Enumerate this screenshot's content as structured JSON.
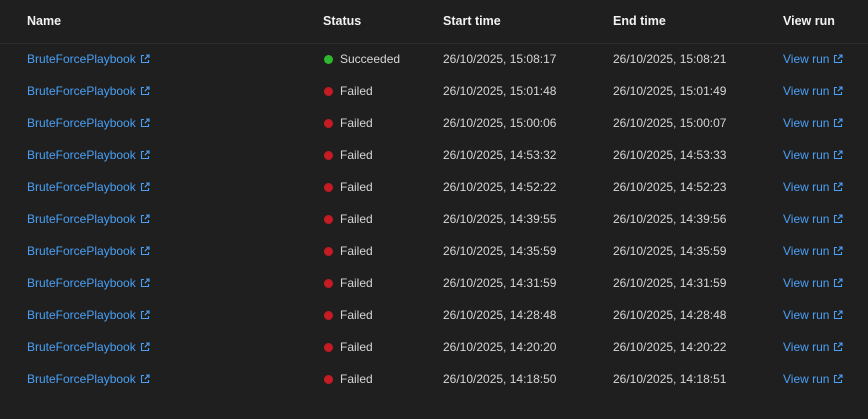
{
  "columns": {
    "name": "Name",
    "status": "Status",
    "start_time": "Start time",
    "end_time": "End time",
    "view_run": "View run"
  },
  "colors": {
    "succeeded": "#2eb82e",
    "failed": "#c41c22",
    "link": "#4aa0f5"
  },
  "rows": [
    {
      "name": "BruteForcePlaybook",
      "status": "Succeeded",
      "start": "26/10/2025, 15:08:17",
      "end": "26/10/2025, 15:08:21",
      "view": "View run"
    },
    {
      "name": "BruteForcePlaybook",
      "status": "Failed",
      "start": "26/10/2025, 15:01:48",
      "end": "26/10/2025, 15:01:49",
      "view": "View run"
    },
    {
      "name": "BruteForcePlaybook",
      "status": "Failed",
      "start": "26/10/2025, 15:00:06",
      "end": "26/10/2025, 15:00:07",
      "view": "View run"
    },
    {
      "name": "BruteForcePlaybook",
      "status": "Failed",
      "start": "26/10/2025, 14:53:32",
      "end": "26/10/2025, 14:53:33",
      "view": "View run"
    },
    {
      "name": "BruteForcePlaybook",
      "status": "Failed",
      "start": "26/10/2025, 14:52:22",
      "end": "26/10/2025, 14:52:23",
      "view": "View run"
    },
    {
      "name": "BruteForcePlaybook",
      "status": "Failed",
      "start": "26/10/2025, 14:39:55",
      "end": "26/10/2025, 14:39:56",
      "view": "View run"
    },
    {
      "name": "BruteForcePlaybook",
      "status": "Failed",
      "start": "26/10/2025, 14:35:59",
      "end": "26/10/2025, 14:35:59",
      "view": "View run"
    },
    {
      "name": "BruteForcePlaybook",
      "status": "Failed",
      "start": "26/10/2025, 14:31:59",
      "end": "26/10/2025, 14:31:59",
      "view": "View run"
    },
    {
      "name": "BruteForcePlaybook",
      "status": "Failed",
      "start": "26/10/2025, 14:28:48",
      "end": "26/10/2025, 14:28:48",
      "view": "View run"
    },
    {
      "name": "BruteForcePlaybook",
      "status": "Failed",
      "start": "26/10/2025, 14:20:20",
      "end": "26/10/2025, 14:20:22",
      "view": "View run"
    },
    {
      "name": "BruteForcePlaybook",
      "status": "Failed",
      "start": "26/10/2025, 14:18:50",
      "end": "26/10/2025, 14:18:51",
      "view": "View run"
    }
  ]
}
